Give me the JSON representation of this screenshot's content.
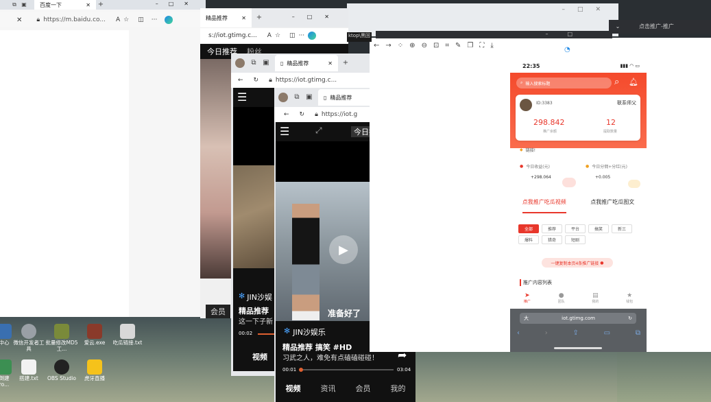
{
  "win_back": {
    "tab_title": "百度一下",
    "url": "https://m.baidu.co...",
    "text_size": "A"
  },
  "win_mid": {
    "tab_title": "精品推荐",
    "url": "s://iot.gtimg.c...",
    "text_size": "A",
    "nav": [
      "今日推荐",
      "粉丝"
    ]
  },
  "right_bar_title": "点击推广-推广",
  "window_code_label": "ktop\\黑回",
  "win_a": {
    "tab_title": "精品推荐",
    "url": "https://iot.gtimg.c...",
    "author": "JIN沙娱",
    "caption_title": "精品推荐",
    "caption_line": "这一下子新",
    "time": "00:02",
    "bottom_nav": [
      "视频"
    ],
    "vip": "会员"
  },
  "win_b": {
    "tab_title": "精品推荐",
    "url": "https://iot.g",
    "top_label": "今日推",
    "author": "JIN沙娱乐",
    "overlay_caption": "准备好了",
    "caption_title": "精品推荐 搞笑 #HD",
    "caption_line": "习武之人，难免有点磕磕碰碰！",
    "time_current": "00:01",
    "time_total": "03:04",
    "bottom_nav": [
      "视频",
      "资讯",
      "会员",
      "我的"
    ]
  },
  "phone": {
    "status_time": "22:35",
    "search_placeholder": "输入搜索标题",
    "user_id": "ID:3383",
    "contact": "联系师父",
    "stat1_value": "298.842",
    "stat1_label": "推广余额",
    "stat2_value": "12",
    "stat2_label": "提取数量",
    "notice": "链接!",
    "today_income_label": "今日收益(元)",
    "today_income_value": "+298.064",
    "today_share_label": "今日分佣+分红(元)",
    "today_share_value": "+0.005",
    "tabs": [
      "点我推广吃瓜视频",
      "点我推广吃瓜图文"
    ],
    "chips_row1": [
      "全部",
      "推荐",
      "平台",
      "搞笑",
      "新三"
    ],
    "chips_row2": [
      "爆料",
      "猎奇",
      "短剧"
    ],
    "copy_btn": "一键复制本页4条推广链接",
    "section_title": "推广内容列表",
    "bottom_nav": [
      "推广",
      "团队",
      "我的",
      "钱包"
    ],
    "url": "iot.gtimg.com",
    "aa": "大"
  },
  "desktop_icons": [
    {
      "label": "中心"
    },
    {
      "label": "微信开发者工具"
    },
    {
      "label": "批量修改MD5工..."
    },
    {
      "label": "爱云.exe"
    },
    {
      "label": "吃瓜链接.txt"
    },
    {
      "label": "倒建\nro..."
    },
    {
      "label": "搭建.txt"
    },
    {
      "label": "OBS Studio"
    },
    {
      "label": "虎牙直播"
    }
  ],
  "colors": {
    "accent_red": "#e8372b",
    "brand_orange": "#f44a2c",
    "edge_blue": "#1e88e5"
  }
}
